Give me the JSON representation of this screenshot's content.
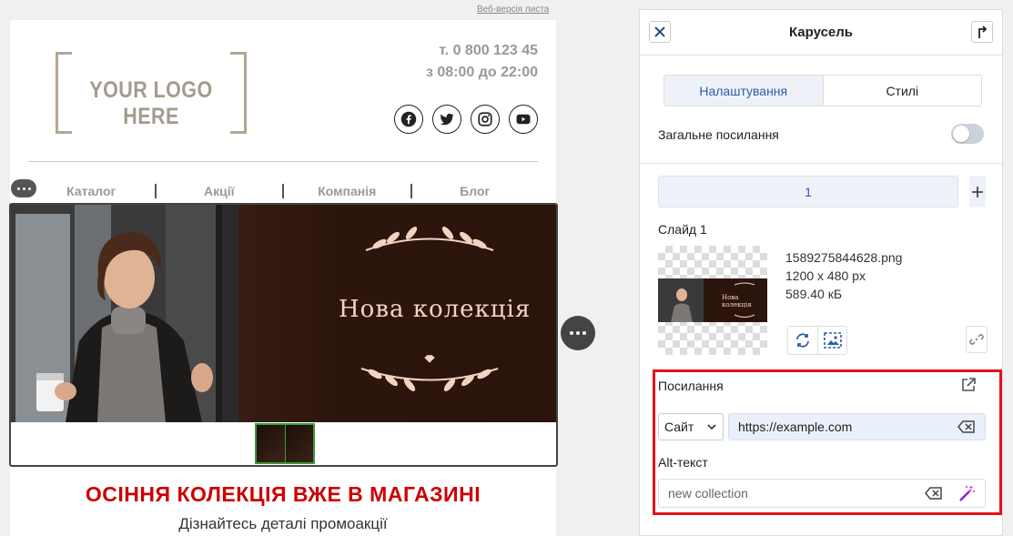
{
  "email": {
    "web_version_link": "Веб-версія листа",
    "logo_text": "YOUR LOGO HERE",
    "phone": "т. 0 800 123 45",
    "hours": "з 08:00 до 22:00",
    "social_icons": [
      "facebook-icon",
      "twitter-icon",
      "instagram-icon",
      "youtube-icon"
    ],
    "nav": [
      "Каталог",
      "Акції",
      "Компанія",
      "Блог"
    ],
    "banner_title": "Нова колекція",
    "headline": "ОСІННЯ КОЛЕКЦІЯ ВЖЕ В МАГАЗИНІ",
    "subline": "Дізнайтесь деталі промоакції",
    "colors": {
      "headline": "#cc0000",
      "banner_bg": "#2c150d",
      "banner_text": "#f3d3c0",
      "thumb_border": "#3a9b3a"
    }
  },
  "panel": {
    "title": "Карусель",
    "tabs": [
      "Налаштування",
      "Стилі"
    ],
    "active_tab": "Налаштування",
    "general_link_label": "Загальне посилання",
    "general_link_enabled": false,
    "slide_tab": "1",
    "slide_label": "Слайд 1",
    "file": {
      "name": "1589275844628.png",
      "dimensions": "1200 x 480 px",
      "size": "589.40 кБ"
    },
    "preview_title": "Нова колекція",
    "link_label": "Посилання",
    "link_type": "Сайт",
    "link_url": "https://example.com",
    "alt_label": "Alt-текст",
    "alt_value": "new collection",
    "highlight_color": "#e8101a"
  }
}
